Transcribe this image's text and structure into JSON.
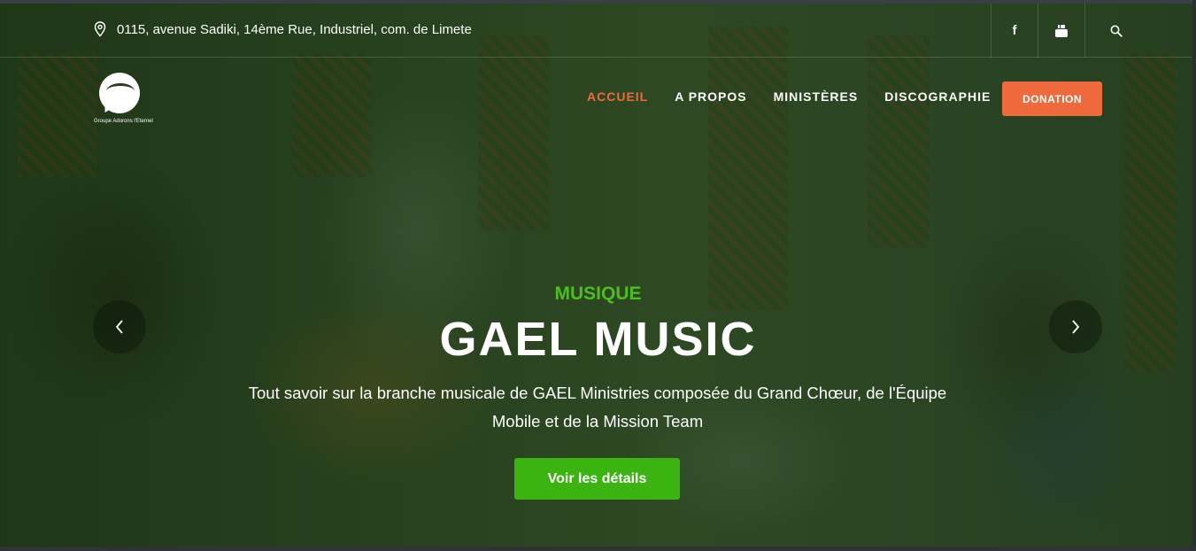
{
  "topbar": {
    "address": "0115, avenue Sadiki, 14ème Rue, Industriel, com. de Limete",
    "socials": [
      {
        "icon": "facebook-icon",
        "glyph": "f"
      },
      {
        "icon": "youtube-icon",
        "glyph": "▶"
      },
      {
        "icon": "search-icon",
        "glyph": ""
      }
    ]
  },
  "logo": {
    "tagline": "Groupe Adorons l'Eternel"
  },
  "nav": {
    "items": [
      "ACCUEIL",
      "A PROPOS",
      "MINISTÈRES",
      "DISCOGRAPHIE"
    ],
    "active": "ACCUEIL",
    "donation_label": "DONATION"
  },
  "slide": {
    "kicker": "MUSIQUE",
    "title": "GAEL MUSIC",
    "description": "Tout savoir sur la branche musicale de GAEL Ministries composée du Grand Chœur, de l'Équipe Mobile et de la Mission Team",
    "cta_label": "Voir les détails"
  },
  "colors": {
    "accent_orange": "#ee6a3c",
    "accent_green": "#3bb412",
    "kicker_green": "#4cbf1f"
  }
}
